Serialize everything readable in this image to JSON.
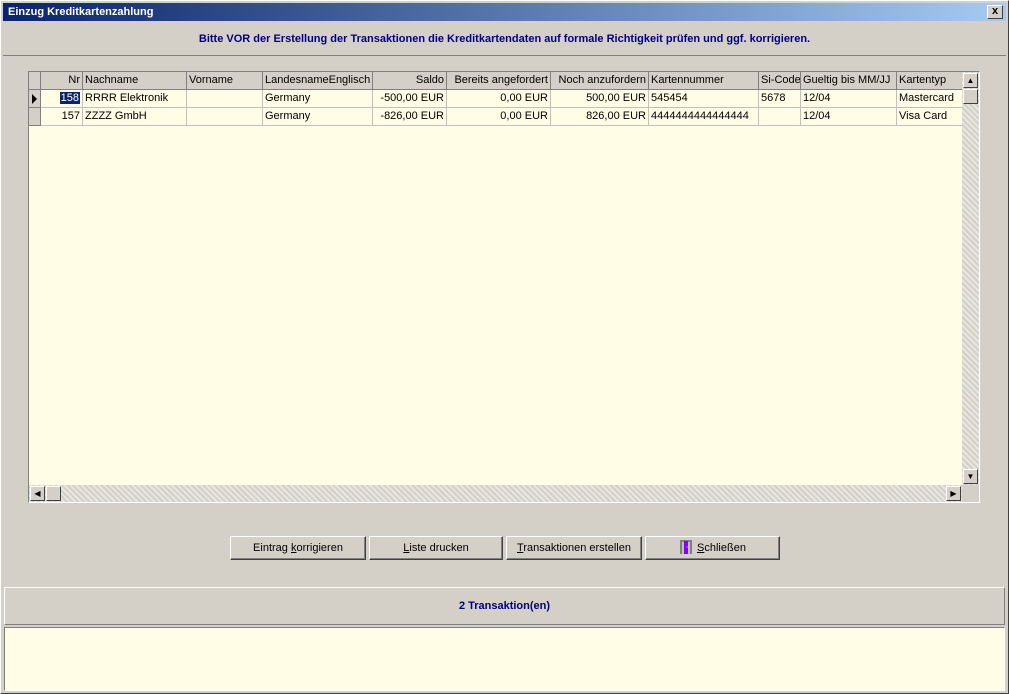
{
  "window": {
    "title": "Einzug Kreditkartenzahlung",
    "close_label": "x"
  },
  "header": {
    "message": "Bitte VOR der Erstellung der Transaktionen die Kreditkartendaten auf formale Richtigkeit prüfen und ggf. korrigieren."
  },
  "grid": {
    "columns": [
      "Nr",
      "Nachname",
      "Vorname",
      "LandesnameEnglisch",
      "Saldo",
      "Bereits angefordert",
      "Noch anzufordern",
      "Kartennummer",
      "Si-Code",
      "Gueltig bis MM/JJ",
      "Kartentyp"
    ],
    "rows": [
      {
        "nr": "158",
        "nachname": "RRRR Elektronik",
        "vorname": "",
        "land": "Germany",
        "saldo": "-500,00 EUR",
        "bereits": "0,00 EUR",
        "noch": "500,00 EUR",
        "kartennummer": "545454",
        "sicode": "5678",
        "gueltig": "12/04",
        "kartentyp": "Mastercard"
      },
      {
        "nr": "157",
        "nachname": "ZZZZ GmbH",
        "vorname": "",
        "land": "Germany",
        "saldo": "-826,00 EUR",
        "bereits": "0,00 EUR",
        "noch": "826,00 EUR",
        "kartennummer": "4444444444444444",
        "sicode": "",
        "gueltig": "12/04",
        "kartentyp": "Visa Card"
      }
    ]
  },
  "buttons": {
    "korrigieren_pre": "Eintrag ",
    "korrigieren_ul": "k",
    "korrigieren_post": "orrigieren",
    "drucken_ul": "L",
    "drucken_post": "iste drucken",
    "erstellen_ul": "T",
    "erstellen_post": "ransaktionen erstellen",
    "schliessen_ul": "S",
    "schliessen_post": "chließen"
  },
  "status": {
    "count_text": "2 Transaktion(en)"
  },
  "colors": {
    "title_start": "#0a246a",
    "title_end": "#a6caf0",
    "accent_text": "#000080",
    "grid_bg": "#fffde6",
    "selection": "#0a246a"
  }
}
